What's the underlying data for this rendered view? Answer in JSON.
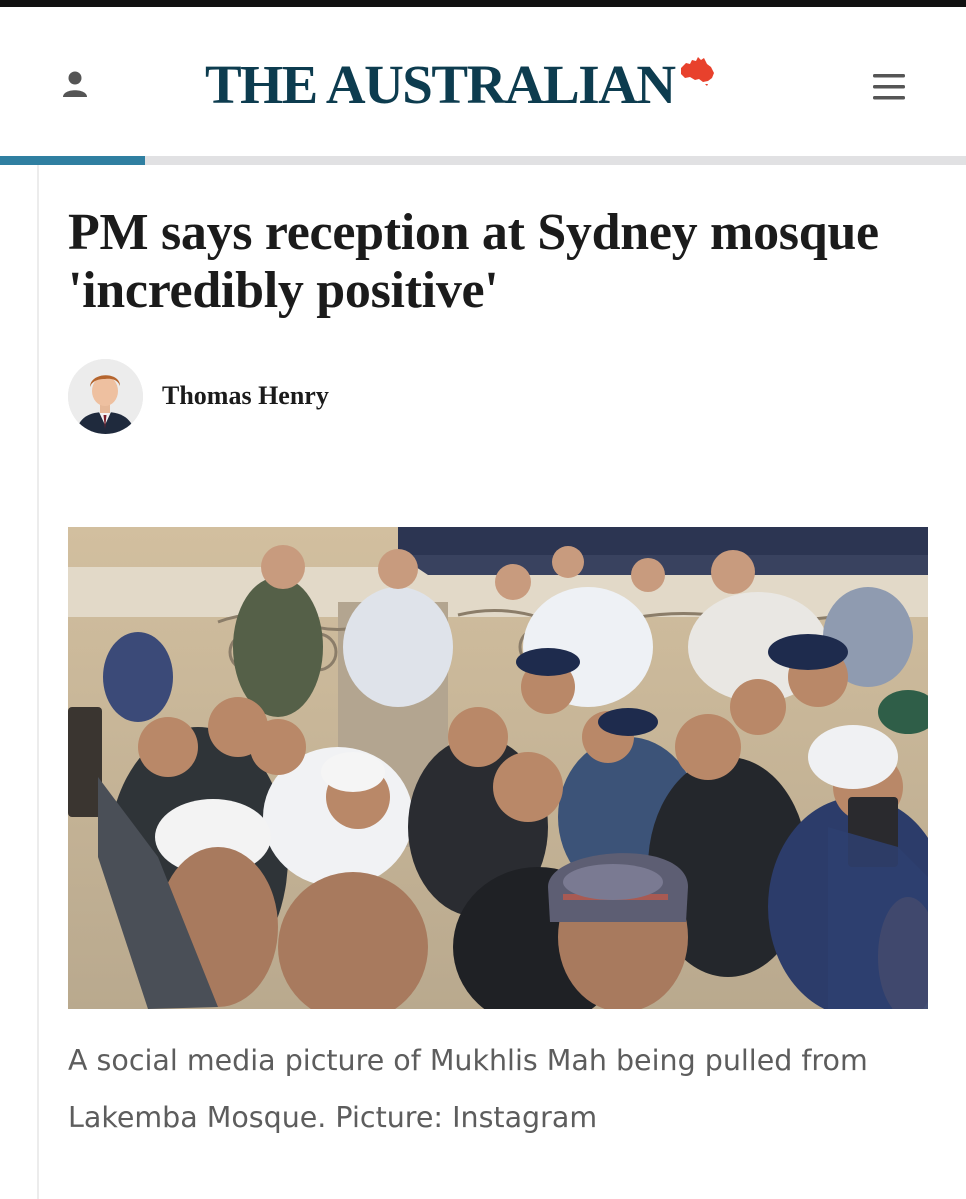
{
  "header": {
    "masthead": "THE AUSTRALIAN",
    "user_icon": "user-icon",
    "menu_icon": "hamburger-menu-icon",
    "logo_icon": "australia-map-icon",
    "brand_color": "#0d3c4f",
    "accent_color": "#e8412c"
  },
  "reading_progress": {
    "fraction": 0.15,
    "color": "#2f7fa1"
  },
  "article": {
    "headline": "PM says reception at Sydney mosque 'incredibly positive'",
    "author": "Thomas Henry",
    "author_avatar": "author-portrait",
    "image": "crowd-photo",
    "caption": "A social media picture of Mukhlis Mah being pulled from Lakemba Mosque. Picture: Instagram"
  }
}
